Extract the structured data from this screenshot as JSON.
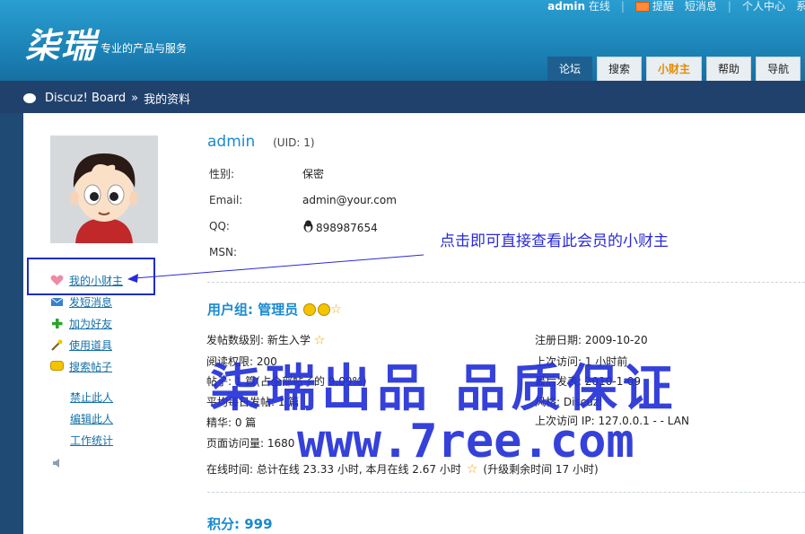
{
  "header": {
    "logo": "柒瑞",
    "tagline": "专业的产品与服务",
    "top_links": {
      "user": "admin",
      "status": "在线",
      "remind": "提醒",
      "message": "短消息",
      "center": "个人中心",
      "more": "系"
    },
    "tabs": [
      "论坛",
      "搜索",
      "小财主",
      "帮助",
      "导航"
    ]
  },
  "breadcrumb": {
    "root": "Discuz! Board",
    "sep": "»",
    "current": "我的资料"
  },
  "sidebar": {
    "links": [
      "我的小财主",
      "发短消息",
      "加为好友",
      "使用道具",
      "搜索帖子"
    ],
    "admin_links": [
      "禁止此人",
      "编辑此人",
      "工作统计"
    ]
  },
  "profile": {
    "username": "admin",
    "uid": "(UID: 1)",
    "fields": [
      {
        "label": "性别:",
        "value": "保密"
      },
      {
        "label": "Email:",
        "value": "admin@your.com"
      },
      {
        "label": "QQ:",
        "value": "898987654"
      },
      {
        "label": "MSN:",
        "value": ""
      }
    ]
  },
  "annotation": "点击即可直接查看此会员的小财主",
  "group": {
    "title": "用户组: 管理员",
    "left": {
      "level": "发帖数级别: 新生入学",
      "read": "阅读权限: 200",
      "posts": "帖子: 1 篇(占全部帖子的 9.09%)",
      "avg": "平均每日发帖: 1 篇",
      "digest": "精华: 0 篇",
      "views": "页面访问量: 1680"
    },
    "right": {
      "reg": "注册日期: 2009-10-20",
      "last_visit": "上次访问: 1 小时前",
      "last_post": "最后发表: 2010-1-09",
      "style": "风格: Discuz!",
      "last_ip": "上次访问 IP: 127.0.0.1 - - LAN"
    },
    "online": "在线时间: 总计在线 23.33 小时, 本月在线 2.67 小时",
    "upgrade": "(升级剩余时间 17 小时)"
  },
  "points": {
    "title": "积分: 999"
  },
  "watermark": {
    "line1": "柒瑞出品  品质保证",
    "line2": "www.7ree.com"
  },
  "colors": {
    "header": "#1a8ccc",
    "nav": "#20416b",
    "link": "#1470a8",
    "title": "#1a8ad0",
    "annotation": "#2a2ad8"
  }
}
